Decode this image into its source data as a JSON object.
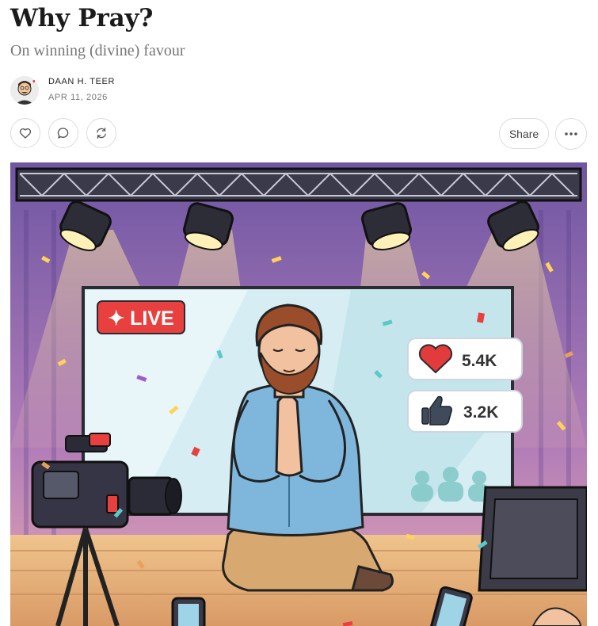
{
  "article": {
    "title": "Why Pray?",
    "subtitle": "On winning (divine) favour"
  },
  "byline": {
    "author": "DAAN H. TEER",
    "date": "APR 11, 2026"
  },
  "actions": {
    "like_icon": "heart-icon",
    "comment_icon": "comment-icon",
    "restack_icon": "restack-icon",
    "share_label": "Share",
    "more_icon": "more-icon"
  },
  "hero_image": {
    "live_label": "✦ LIVE",
    "hearts_count": "5.4K",
    "likes_count": "3.2K",
    "colors": {
      "live_red": "#e8403f",
      "stage_purple": "#7b5fa6",
      "screen_blue": "#cde9f0"
    }
  }
}
